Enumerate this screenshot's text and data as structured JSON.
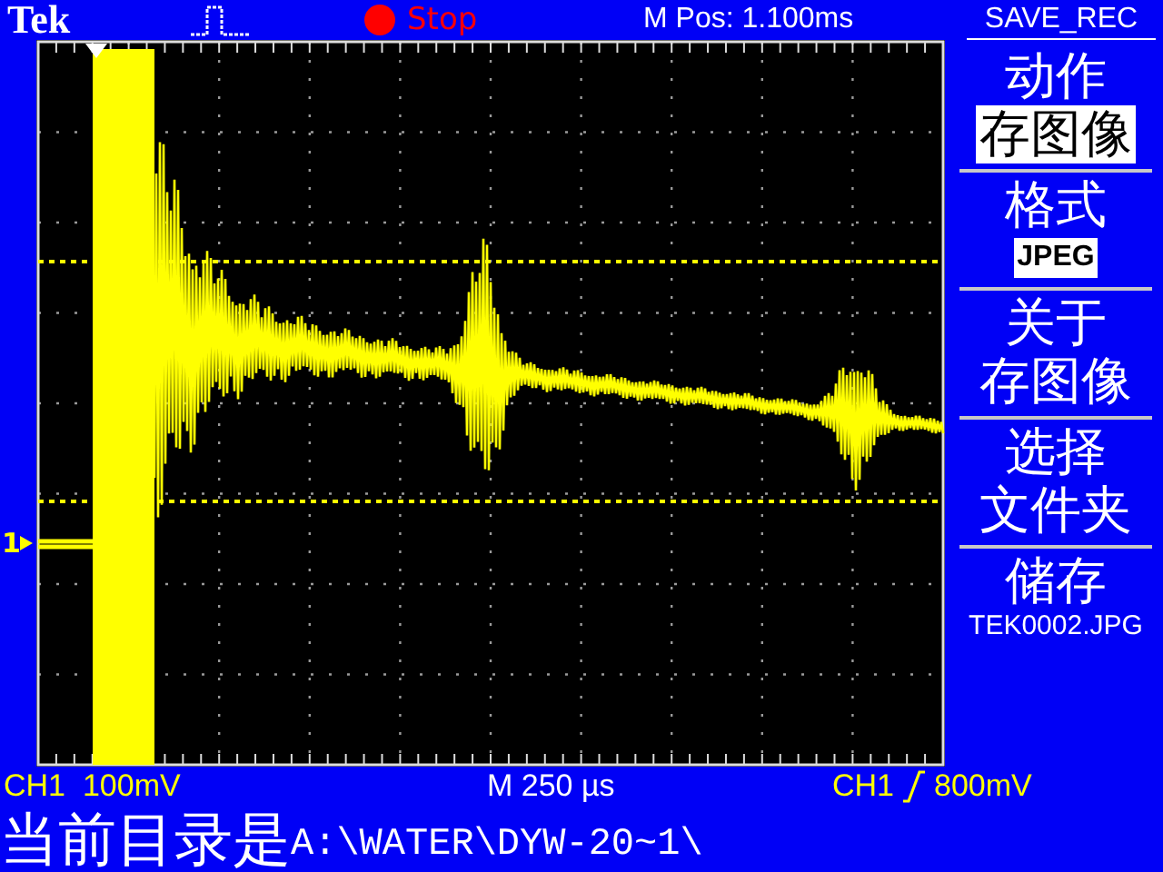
{
  "header": {
    "brand": "Tek",
    "run_state": "Stop",
    "position": "M Pos: 1.100ms",
    "menu_title": "SAVE_REC"
  },
  "ch1_marker": "1",
  "menu": [
    {
      "kind": "option",
      "label": "动作",
      "value": "存图像"
    },
    {
      "kind": "option",
      "label": "格式",
      "value": "JPEG"
    },
    {
      "kind": "action",
      "lines": [
        "关于",
        "存图像"
      ]
    },
    {
      "kind": "action",
      "lines": [
        "选择",
        "文件夹"
      ]
    },
    {
      "kind": "file",
      "label": "储存",
      "value": "TEK0002.JPG"
    }
  ],
  "readouts": {
    "channel": "CH1  100mV",
    "timebase": "M 250 µs",
    "trigger_source": "CH1",
    "trigger_level": "800mV"
  },
  "directory": {
    "label": "当前目录是",
    "path": "A:\\WATER\\DYW-20~1\\"
  }
}
